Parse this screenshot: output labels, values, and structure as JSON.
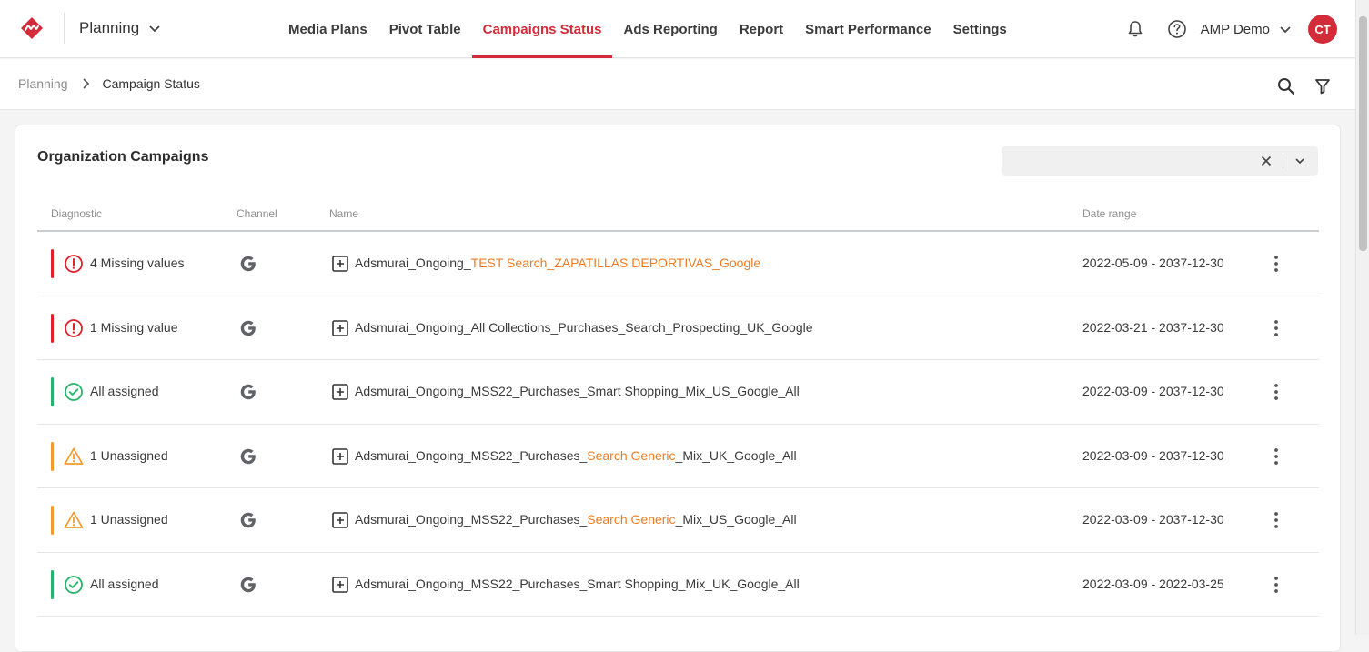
{
  "colors": {
    "accent": "#d42b3a",
    "error": "#e0202b",
    "success": "#27b46a",
    "warning": "#f39a2e",
    "highlight": "#ef7c22"
  },
  "header": {
    "app_switcher": "Planning",
    "nav": [
      {
        "label": "Media Plans",
        "active": false
      },
      {
        "label": "Pivot Table",
        "active": false
      },
      {
        "label": "Campaigns Status",
        "active": true
      },
      {
        "label": "Ads Reporting",
        "active": false
      },
      {
        "label": "Report",
        "active": false
      },
      {
        "label": "Smart Performance",
        "active": false
      },
      {
        "label": "Settings",
        "active": false
      }
    ],
    "account_name": "AMP Demo",
    "avatar_initials": "CT"
  },
  "breadcrumb": {
    "root": "Planning",
    "current": "Campaign Status"
  },
  "card": {
    "title": "Organization Campaigns",
    "select_value": ""
  },
  "table": {
    "columns": {
      "diagnostic": "Diagnostic",
      "channel": "Channel",
      "name": "Name",
      "date_range": "Date range"
    },
    "rows": [
      {
        "status": "error",
        "status_icon": "error-circle-icon",
        "diagnostic": "4 Missing values",
        "channel_icon": "google-icon",
        "name_prefix": "Adsmurai_Ongoing_",
        "name_highlight": "TEST Search_ZAPATILLAS DEPORTIVAS_Google",
        "name_suffix": "",
        "date_range": "2022-05-09 - 2037-12-30"
      },
      {
        "status": "error",
        "status_icon": "error-circle-icon",
        "diagnostic": "1 Missing value",
        "channel_icon": "google-icon",
        "name_prefix": "Adsmurai_Ongoing_All Collections_Purchases_Search_Prospecting_UK_Google",
        "name_highlight": "",
        "name_suffix": "",
        "date_range": "2022-03-21 - 2037-12-30"
      },
      {
        "status": "success",
        "status_icon": "check-circle-icon",
        "diagnostic": "All assigned",
        "channel_icon": "google-icon",
        "name_prefix": "Adsmurai_Ongoing_MSS22_Purchases_Smart Shopping_Mix_US_Google_All",
        "name_highlight": "",
        "name_suffix": "",
        "date_range": "2022-03-09 - 2037-12-30"
      },
      {
        "status": "warning",
        "status_icon": "warning-triangle-icon",
        "diagnostic": "1 Unassigned",
        "channel_icon": "google-icon",
        "name_prefix": "Adsmurai_Ongoing_MSS22_Purchases_",
        "name_highlight": "Search Generic",
        "name_suffix": "_Mix_UK_Google_All",
        "date_range": "2022-03-09 - 2037-12-30"
      },
      {
        "status": "warning",
        "status_icon": "warning-triangle-icon",
        "diagnostic": "1 Unassigned",
        "channel_icon": "google-icon",
        "name_prefix": "Adsmurai_Ongoing_MSS22_Purchases_",
        "name_highlight": "Search Generic",
        "name_suffix": "_Mix_US_Google_All",
        "date_range": "2022-03-09 - 2037-12-30"
      },
      {
        "status": "success",
        "status_icon": "check-circle-icon",
        "diagnostic": "All assigned",
        "channel_icon": "google-icon",
        "name_prefix": "Adsmurai_Ongoing_MSS22_Purchases_Smart Shopping_Mix_UK_Google_All",
        "name_highlight": "",
        "name_suffix": "",
        "date_range": "2022-03-09 - 2022-03-25"
      }
    ]
  }
}
